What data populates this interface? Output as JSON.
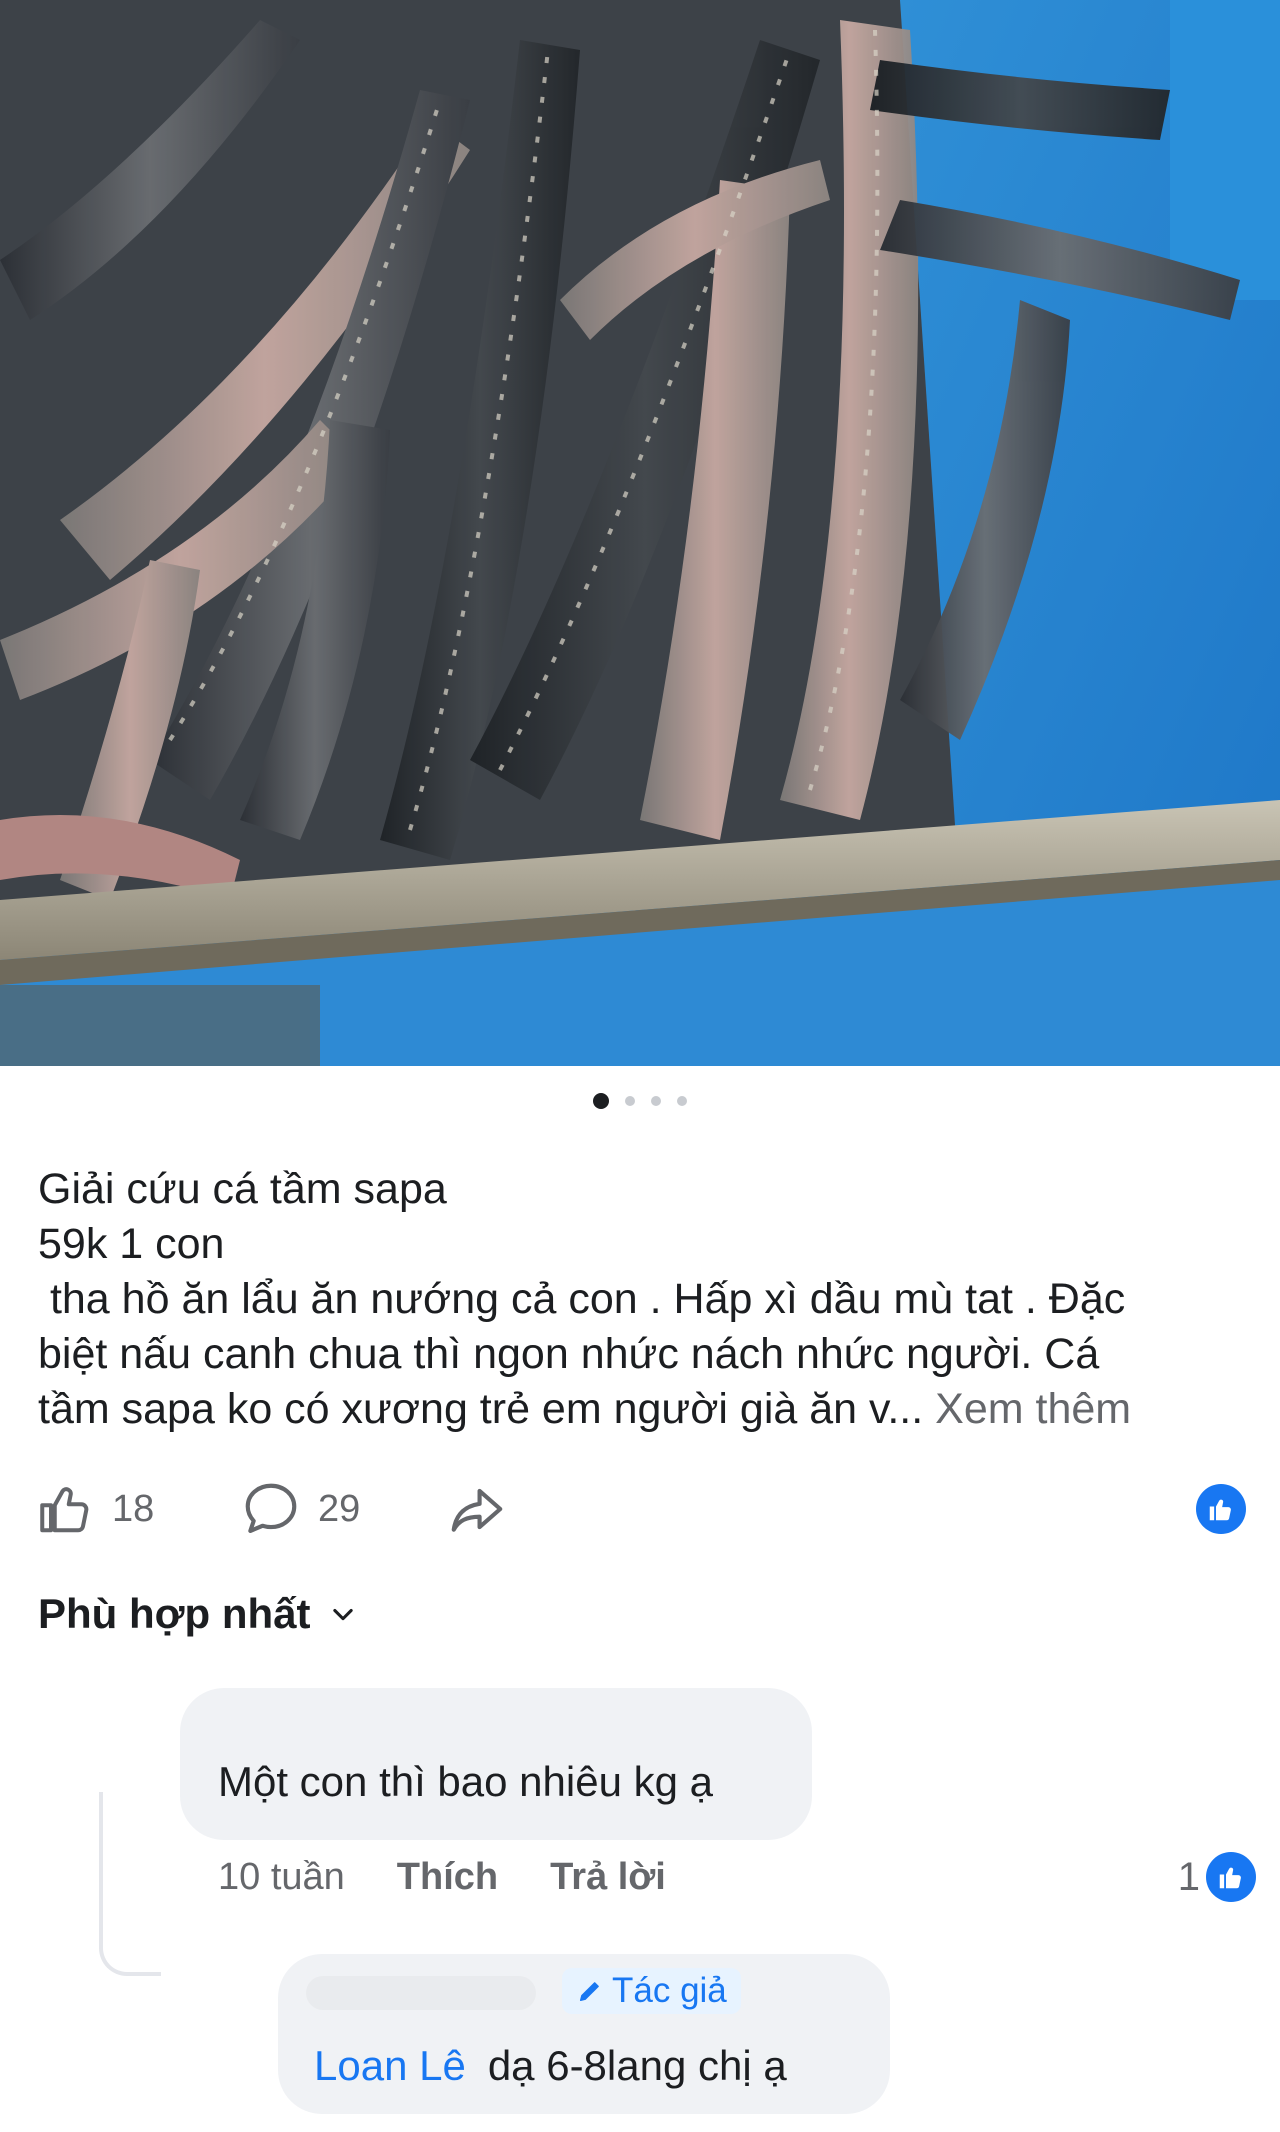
{
  "post": {
    "caption_lines": [
      "Giải cứu cá tầm sapa",
      "59k 1 con",
      " tha hồ ăn lẩu ăn nướng cả con . Hấp xì dầu mù tat . Đặc",
      "biệt nấu canh chua thì ngon nhức nách nhức người. Cá",
      "tầm sapa ko có xương trẻ em người già ăn v..."
    ],
    "see_more": "Xem thêm",
    "carousel": {
      "count": 4,
      "active_index": 0
    }
  },
  "actions": {
    "likes": "18",
    "comments": "29",
    "like_icon": "thumbs-up-icon",
    "comment_icon": "speech-bubble-icon",
    "share_icon": "share-arrow-icon",
    "reaction_badge_icon": "like-reaction-icon"
  },
  "sort": {
    "label": "Phù hợp nhất",
    "icon": "chevron-down-icon"
  },
  "comments": [
    {
      "text": "Một con thì bao nhiêu kg ạ",
      "time": "10 tuần",
      "like_label": "Thích",
      "reply_label": "Trả lời",
      "reaction_count": "1"
    }
  ],
  "reply": {
    "badge": "Tác giả",
    "badge_icon": "pencil-icon",
    "author": "Loan Lê",
    "text": "dạ 6-8lang chị ạ"
  },
  "colors": {
    "accent": "#1877f2",
    "text": "#1c1e21",
    "muted": "#65676b",
    "bubble": "#f0f2f5"
  }
}
